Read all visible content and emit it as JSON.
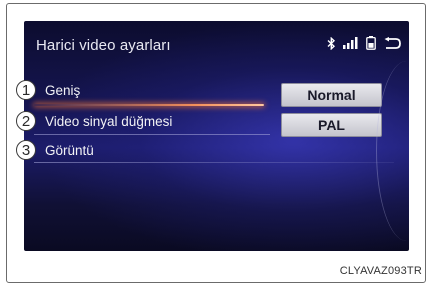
{
  "header": {
    "title": "Harici video ayarları",
    "icons": [
      "bluetooth-icon",
      "signal-bars-icon",
      "phone-battery-icon",
      "back-icon"
    ]
  },
  "settings": [
    {
      "callout": "1",
      "label": "Geniş",
      "value": "Normal",
      "selected": true
    },
    {
      "callout": "2",
      "label": "Video sinyal düğmesi",
      "value": "PAL",
      "selected": false
    },
    {
      "callout": "3",
      "label": "Görüntü",
      "value": null,
      "selected": false
    }
  ],
  "figure_code": "CLYAVAZ093TR",
  "colors": {
    "screen_background": "#151550",
    "selection_glow": "#ff8a50",
    "button_face": "#d8d8de",
    "text": "#f2f2f5"
  }
}
